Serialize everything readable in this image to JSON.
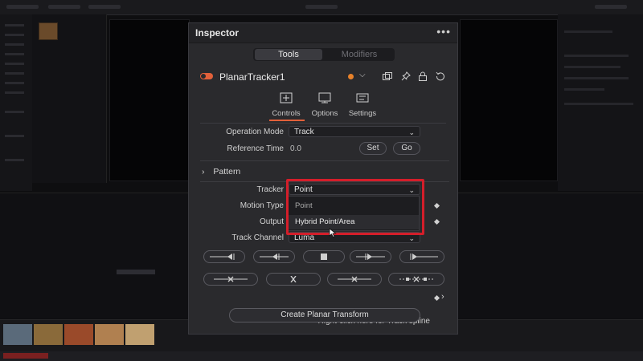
{
  "inspector": {
    "title": "Inspector",
    "menu_label": "•••",
    "segment": {
      "tools": "Tools",
      "modifiers": "Modifiers"
    },
    "node_name": "PlanarTracker1",
    "tabs": [
      {
        "label": "Controls",
        "icon": "controls-icon"
      },
      {
        "label": "Options",
        "icon": "options-icon"
      },
      {
        "label": "Settings",
        "icon": "settings-icon"
      }
    ],
    "operation_mode": {
      "label": "Operation Mode",
      "value": "Track"
    },
    "reference_time": {
      "label": "Reference Time",
      "value": "0.0",
      "set_label": "Set",
      "go_label": "Go"
    },
    "pattern": {
      "label": "Pattern"
    },
    "tracker": {
      "label": "Tracker",
      "value": "Point",
      "options": [
        "Point",
        "Hybrid Point/Area"
      ]
    },
    "motion_type": {
      "label": "Motion Type"
    },
    "output": {
      "label": "Output"
    },
    "track_channel": {
      "label": "Track Channel",
      "value": "Luma"
    },
    "footer_hint": "Right-click here for Track spline",
    "create_button": "Create Planar Transform"
  },
  "colors": {
    "accent_orange": "#e2603a",
    "highlight_red": "#d41e2a",
    "panel_bg": "#2a2a2d"
  }
}
